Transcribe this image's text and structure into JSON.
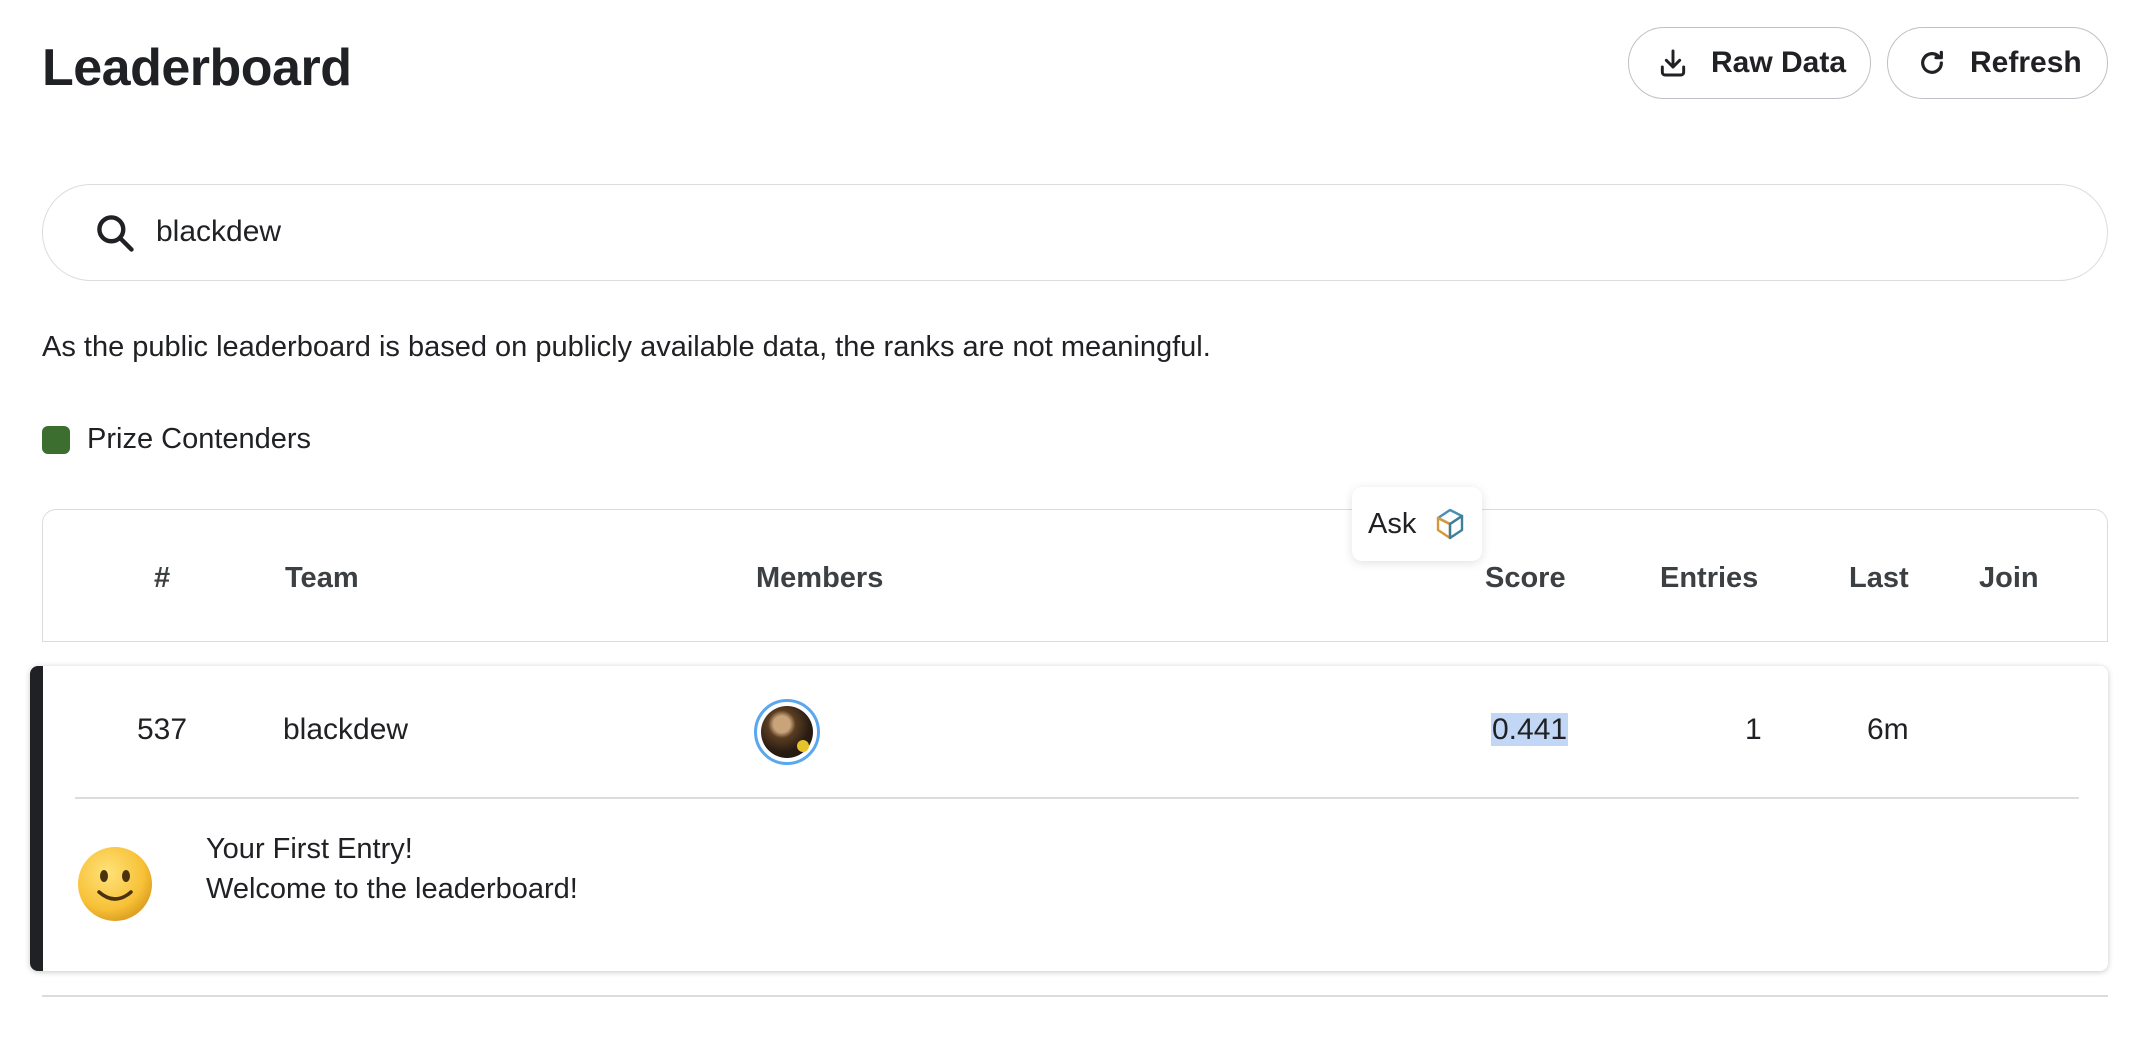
{
  "header": {
    "title": "Leaderboard",
    "raw_data_label": "Raw Data",
    "refresh_label": "Refresh",
    "raw_data_icon": "download-icon",
    "refresh_icon": "refresh-icon"
  },
  "search": {
    "value": "blackdew",
    "placeholder": "Search leaderboard",
    "icon": "search-icon"
  },
  "notice": "As the public leaderboard is based on publicly available data, the ranks are not meaningful.",
  "legend": {
    "label": "Prize Contenders",
    "color": "#3c6e2f"
  },
  "ask": {
    "label": "Ask",
    "icon": "gemini-spark-icon"
  },
  "table": {
    "columns": {
      "rank": "#",
      "team": "Team",
      "members": "Members",
      "score": "Score",
      "entries": "Entries",
      "last": "Last",
      "join": "Join"
    },
    "rows": [
      {
        "rank": "537",
        "team": "blackdew",
        "score": "0.441",
        "entries": "1",
        "last": "6m",
        "join": "",
        "accent_color": "#202124",
        "message": {
          "line1": "Your First Entry!",
          "line2": "Welcome to the leaderboard!",
          "icon": "smiley-icon"
        }
      }
    ]
  }
}
